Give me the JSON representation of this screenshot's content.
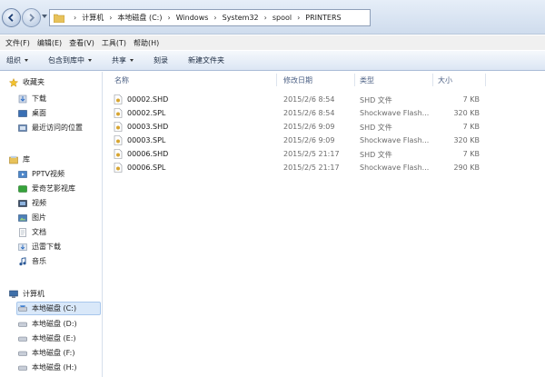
{
  "address": {
    "crumbs": [
      "计算机",
      "本地磁盘 (C:)",
      "Windows",
      "System32",
      "spool",
      "PRINTERS"
    ]
  },
  "menu": [
    "文件(F)",
    "编辑(E)",
    "查看(V)",
    "工具(T)",
    "帮助(H)"
  ],
  "commands": [
    {
      "label": "组织",
      "dropdown": true
    },
    {
      "label": "包含到库中",
      "dropdown": true
    },
    {
      "label": "共享",
      "dropdown": true
    },
    {
      "label": "刻录",
      "dropdown": false
    },
    {
      "label": "新建文件夹",
      "dropdown": false
    }
  ],
  "nav": {
    "favorites": {
      "title": "收藏夹",
      "items": [
        "下载",
        "桌面",
        "最近访问的位置"
      ]
    },
    "libraries": {
      "title": "库",
      "items": [
        "PPTV视频",
        "爱奇艺影视库",
        "视频",
        "图片",
        "文档",
        "迅雷下载",
        "音乐"
      ]
    },
    "computer": {
      "title": "计算机",
      "items": [
        "本地磁盘 (C:)",
        "本地磁盘 (D:)",
        "本地磁盘 (E:)",
        "本地磁盘 (F:)",
        "本地磁盘 (H:)"
      ],
      "selected": "本地磁盘 (C:)"
    }
  },
  "columns": {
    "name": "名称",
    "modified": "修改日期",
    "type": "类型",
    "size": "大小"
  },
  "files": [
    {
      "name": "00002.SHD",
      "modified": "2015/2/6 8:54",
      "type": "SHD 文件",
      "size": "7 KB"
    },
    {
      "name": "00002.SPL",
      "modified": "2015/2/6 8:54",
      "type": "Shockwave Flash...",
      "size": "320 KB"
    },
    {
      "name": "00003.SHD",
      "modified": "2015/2/6 9:09",
      "type": "SHD 文件",
      "size": "7 KB"
    },
    {
      "name": "00003.SPL",
      "modified": "2015/2/6 9:09",
      "type": "Shockwave Flash...",
      "size": "320 KB"
    },
    {
      "name": "00006.SHD",
      "modified": "2015/2/5 21:17",
      "type": "SHD 文件",
      "size": "7 KB"
    },
    {
      "name": "00006.SPL",
      "modified": "2015/2/5 21:17",
      "type": "Shockwave Flash...",
      "size": "290 KB"
    }
  ]
}
